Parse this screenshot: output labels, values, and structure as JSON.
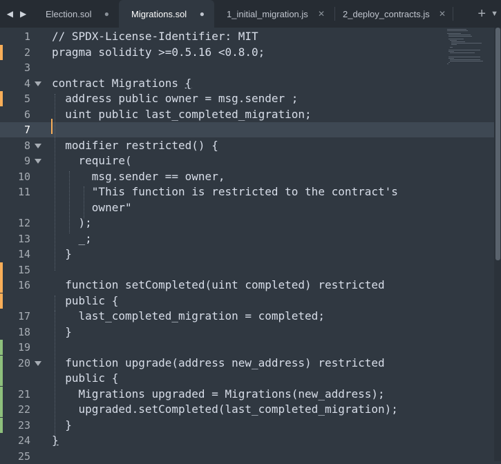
{
  "tabs": [
    {
      "label": "Election.sol",
      "dirty": true,
      "active": false
    },
    {
      "label": "Migrations.sol",
      "dirty": true,
      "active": true
    },
    {
      "label": "1_initial_migration.js",
      "dirty": false,
      "active": false
    },
    {
      "label": "2_deploy_contracts.js",
      "dirty": false,
      "active": false
    }
  ],
  "icons": {
    "nav_back": "◀",
    "nav_forward": "▶",
    "dirty_dot": "●",
    "close": "✕",
    "new_tab": "+",
    "overflow": "▼"
  },
  "colors": {
    "modified": "#f9ae58",
    "added": "#8ec07c",
    "editor_bg": "#303841",
    "tabbar_bg": "#262c33"
  },
  "editor": {
    "current_line": 7,
    "lines": [
      {
        "n": "1",
        "text": "// SPDX-License-Identifier: MIT",
        "mark": ""
      },
      {
        "n": "2",
        "text": "pragma solidity >=0.5.16 <0.8.0;",
        "mark": "modified"
      },
      {
        "n": "3",
        "text": "",
        "mark": ""
      },
      {
        "n": "4",
        "text": "contract Migrations {",
        "mark": "",
        "fold": true
      },
      {
        "n": "5",
        "text": "  address public owner = msg.sender ;",
        "mark": "modified"
      },
      {
        "n": "6",
        "text": "  uint public last_completed_migration;",
        "mark": ""
      },
      {
        "n": "7",
        "text": "",
        "mark": ""
      },
      {
        "n": "8",
        "text": "  modifier restricted() {",
        "mark": "",
        "fold": true
      },
      {
        "n": "9",
        "text": "    require(",
        "mark": "",
        "fold": true
      },
      {
        "n": "10",
        "text": "      msg.sender == owner,",
        "mark": ""
      },
      {
        "n": "11",
        "text": "      \"This function is restricted to the contract's",
        "mark": ""
      },
      {
        "n": "",
        "text": "      owner\"",
        "mark": ""
      },
      {
        "n": "12",
        "text": "    );",
        "mark": ""
      },
      {
        "n": "13",
        "text": "    _;",
        "mark": ""
      },
      {
        "n": "14",
        "text": "  }",
        "mark": ""
      },
      {
        "n": "15",
        "text": "",
        "mark": "modified"
      },
      {
        "n": "16",
        "text": "  function setCompleted(uint completed) restricted",
        "mark": "modified"
      },
      {
        "n": "",
        "text": "  public {",
        "mark": "modified"
      },
      {
        "n": "17",
        "text": "    last_completed_migration = completed;",
        "mark": ""
      },
      {
        "n": "18",
        "text": "  }",
        "mark": ""
      },
      {
        "n": "19",
        "text": "",
        "mark": "added"
      },
      {
        "n": "20",
        "text": "  function upgrade(address new_address) restricted",
        "mark": "added",
        "fold": true
      },
      {
        "n": "",
        "text": "  public {",
        "mark": "added"
      },
      {
        "n": "21",
        "text": "    Migrations upgraded = Migrations(new_address);",
        "mark": "added"
      },
      {
        "n": "22",
        "text": "    upgraded.setCompleted(last_completed_migration);",
        "mark": "added"
      },
      {
        "n": "23",
        "text": "  }",
        "mark": "added"
      },
      {
        "n": "24",
        "text": "}",
        "mark": ""
      },
      {
        "n": "25",
        "text": "",
        "mark": ""
      }
    ]
  }
}
